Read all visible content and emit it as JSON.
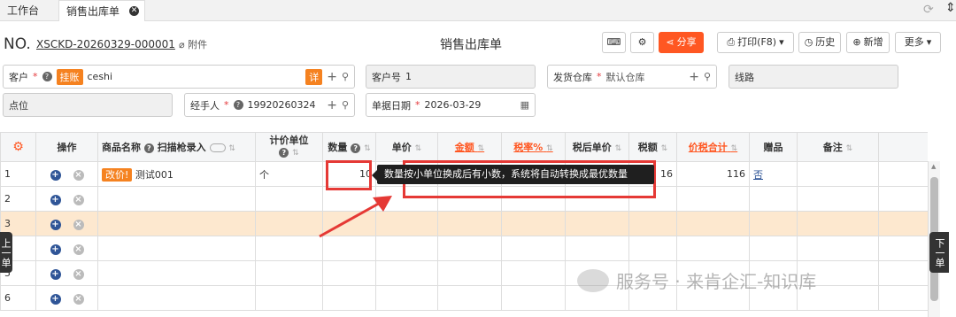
{
  "tabs": {
    "home": "工作台",
    "current": "销售出库单"
  },
  "header": {
    "no_prefix": "NO.",
    "doc_no": "XSCKD-20260329-000001",
    "attach": "附件",
    "title": "销售出库单"
  },
  "toolbar": {
    "share": "分享",
    "print": "打印(F8)",
    "history": "历史",
    "new": "新增",
    "more": "更多"
  },
  "form": {
    "customer_label": "客户",
    "customer_tag": "挂账",
    "customer_value": "ceshi",
    "detail_tag": "详",
    "cust_no_label": "客户号",
    "cust_no_value": "1",
    "warehouse_label": "发货仓库",
    "warehouse_value": "默认仓库",
    "route_label": "线路",
    "point_label": "点位",
    "handler_label": "经手人",
    "handler_value": "19920260324",
    "date_label": "单据日期",
    "date_value": "2026-03-29"
  },
  "table": {
    "headers": {
      "op": "操作",
      "name": "商品名称",
      "scan": "扫描枪录入",
      "unit": "计价单位",
      "qty": "数量",
      "price": "单价",
      "amount": "金额",
      "taxrate": "税率%",
      "aftertax": "税后单价",
      "tax": "税额",
      "total": "价税合计",
      "gift": "赠品",
      "remark": "备注"
    },
    "rows": [
      {
        "n": "1",
        "tag": "改价!",
        "name": "测试001",
        "unit": "个",
        "qty": "10",
        "tax": "16",
        "total": "116",
        "gift": "否"
      },
      {
        "n": "2"
      },
      {
        "n": "3"
      },
      {
        "n": "4"
      },
      {
        "n": "5"
      },
      {
        "n": "6"
      }
    ]
  },
  "tooltip": "数量按小单位换成后有小数，系统将自动转换成最优数量",
  "nav": {
    "prev": "上一单",
    "next": "下一单"
  },
  "watermark": "服务号 · 来肯企汇-知识库",
  "colors": {
    "accent": "#ff5722",
    "orange": "#f58220",
    "selected_row": "#fde8cf",
    "annotation": "#e53935"
  }
}
